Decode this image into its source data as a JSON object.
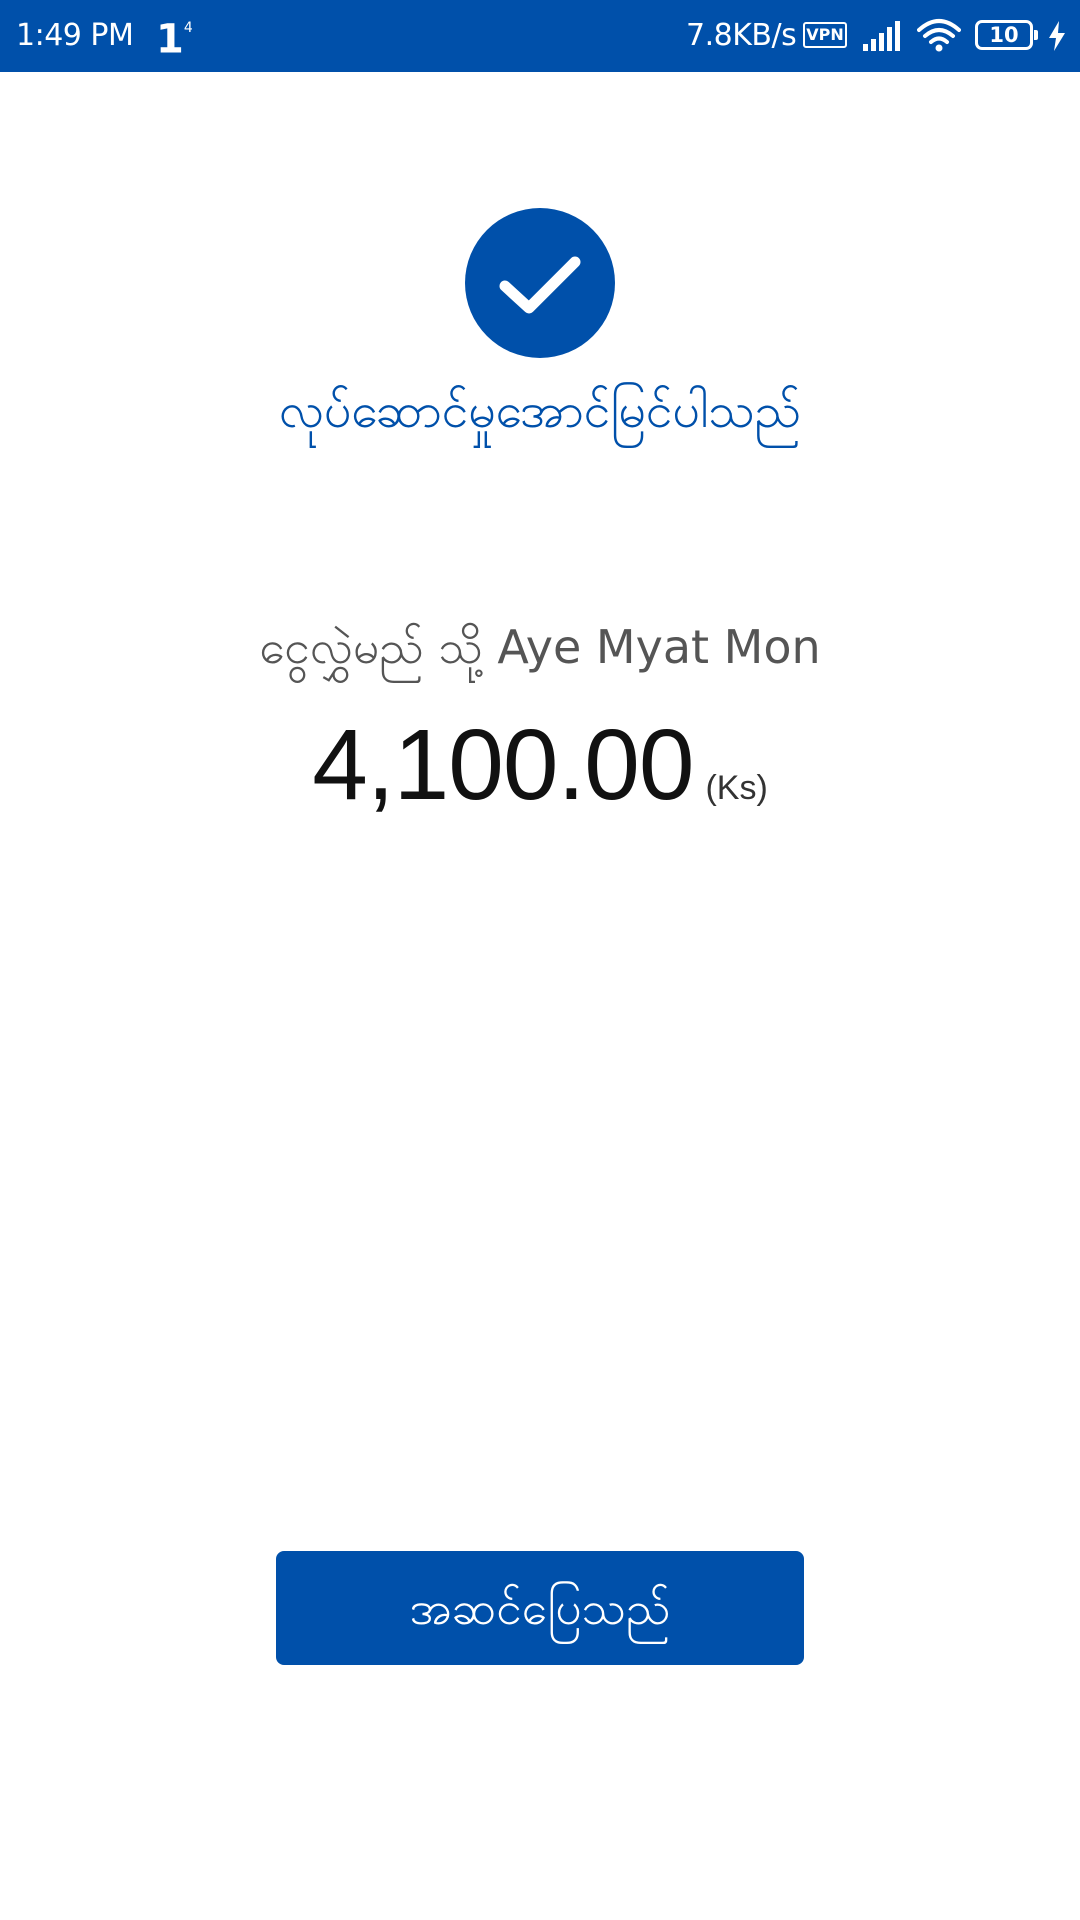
{
  "status_bar": {
    "time": "1:49 PM",
    "notification_count": "1",
    "notification_superscript": "4",
    "network_speed": "7.8KB/s",
    "vpn_label": "VPN",
    "battery_level": "10"
  },
  "result": {
    "title": "လုပ်ဆောင်မှုအောင်မြင်ပါသည်",
    "recipient_text": "ငွေလွှဲမည် သို့ Aye Myat Mon",
    "amount": "4,100.00",
    "currency": "(Ks)"
  },
  "actions": {
    "done_label": "အဆင်ပြေသည်"
  },
  "colors": {
    "primary": "#0050aa",
    "background": "#ffffff",
    "secondary_text": "#555555"
  },
  "icons": [
    "check-icon",
    "signal-icon",
    "wifi-icon",
    "battery-icon",
    "charging-icon"
  ]
}
